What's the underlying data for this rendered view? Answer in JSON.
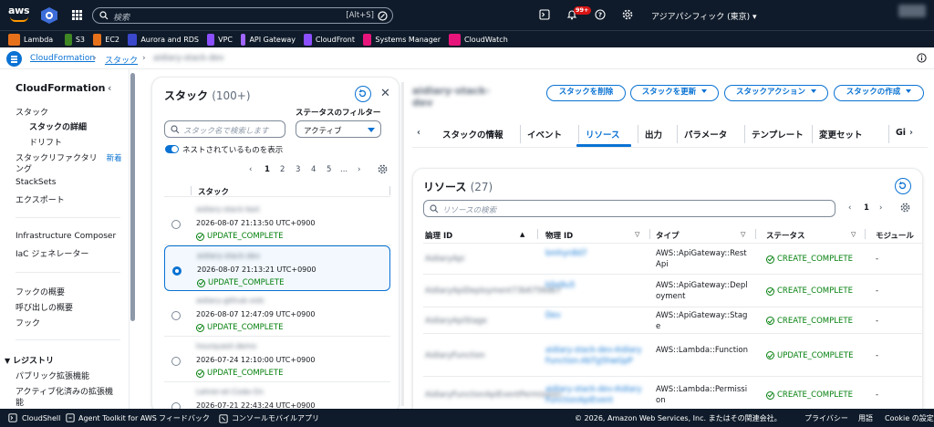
{
  "topbar": {
    "search_placeholder": "検索",
    "search_shortcut": "[Alt+S]",
    "notification_badge": "99+",
    "region": "アジアパシフィック (東京)"
  },
  "favorites": [
    {
      "label": "Lambda",
      "color": "#e7711b"
    },
    {
      "label": "S3",
      "color": "#3f8624"
    },
    {
      "label": "EC2",
      "color": "#e7711b"
    },
    {
      "label": "Aurora and RDS",
      "color": "#3b48cc"
    },
    {
      "label": "VPC",
      "color": "#8c4fff"
    },
    {
      "label": "API Gateway",
      "color": "#a166ff"
    },
    {
      "label": "CloudFront",
      "color": "#8c4fff"
    },
    {
      "label": "Systems Manager",
      "color": "#e7157b"
    },
    {
      "label": "CloudWatch",
      "color": "#e7157b"
    }
  ],
  "breadcrumb": {
    "service": "CloudFormation",
    "stacks": "スタック",
    "current": "aidiary-stack-dev"
  },
  "sidenav": {
    "title": "CloudFormation",
    "items": [
      {
        "label": "スタック",
        "level": 0
      },
      {
        "label": "スタックの詳細",
        "level": 1,
        "active": true
      },
      {
        "label": "ドリフト",
        "level": 1
      },
      {
        "label": "スタックリファクタリ",
        "level": 0,
        "badge": "新着"
      },
      {
        "label": "ング",
        "level": 0
      },
      {
        "label": "StackSets",
        "level": 0
      },
      {
        "label": "エクスポート",
        "level": 0
      },
      {
        "label": "Infrastructure Composer",
        "level": 0
      },
      {
        "label": "IaC ジェネレーター",
        "level": 0
      },
      {
        "label": "フックの概要",
        "level": 0
      },
      {
        "label": "呼び出しの概要",
        "level": 0
      },
      {
        "label": "フック",
        "level": 0
      }
    ],
    "registry_heading": "レジストリ",
    "registry_items": [
      "パブリック拡張機能",
      "アクティブ化済みの拡張機",
      "能"
    ]
  },
  "stack_panel": {
    "title": "スタック",
    "count": "(100+)",
    "search_placeholder": "スタック名で検索します",
    "filter_label": "ステータスのフィルター",
    "filter_value": "アクティブ",
    "nested_toggle_label": "ネストされているものを表示",
    "pages": [
      "1",
      "2",
      "3",
      "4",
      "5",
      "..."
    ],
    "column": "スタック",
    "rows": [
      {
        "name": "aidiary-stack-test",
        "time": "2026-08-07 21:13:50 UTC+0900",
        "status": "UPDATE_COMPLETE",
        "selected": false
      },
      {
        "name": "aidiary-stack-dev",
        "time": "2026-08-07 21:13:21 UTC+0900",
        "status": "UPDATE_COMPLETE",
        "selected": true
      },
      {
        "name": "aidiary-github-oidc",
        "time": "2026-08-07 12:47:09 UTC+0900",
        "status": "UPDATE_COMPLETE",
        "selected": false
      },
      {
        "name": "hourquest-demo",
        "time": "2026-07-24 12:10:00 UTC+0900",
        "status": "UPDATE_COMPLETE",
        "selected": false
      },
      {
        "name": "Lehrer-et-Code-On",
        "time": "2026-07-21 22:43:24 UTC+0900",
        "status": "UPDATE_COMPLETE",
        "selected": false
      }
    ]
  },
  "main": {
    "stack_name": "aidiary-stack-dev",
    "buttons": {
      "delete": "スタックを削除",
      "update": "スタックを更新",
      "actions": "スタックアクション",
      "create": "スタックの作成"
    },
    "tabs": [
      "スタックの情報",
      "イベント",
      "リソース",
      "出力",
      "パラメータ",
      "テンプレート",
      "変更セット",
      "Gi"
    ],
    "active_tab": "リソース"
  },
  "resources": {
    "title": "リソース",
    "count": "(27)",
    "search_placeholder": "リソースの検索",
    "page": "1",
    "columns": [
      "論理 ID",
      "物理 ID",
      "タイプ",
      "ステータス",
      "モジュール"
    ],
    "rows": [
      {
        "logical": "AidiaryApi",
        "physical": "bmhyn8d7",
        "type": "AWS::ApiGateway::RestApi",
        "status": "CREATE_COMPLETE",
        "module": "-"
      },
      {
        "logical": "AidiaryApiDeployment73b6756db7",
        "physical": "b5e9u5",
        "type": "AWS::ApiGateway::Deployment",
        "status": "CREATE_COMPLETE",
        "module": "-"
      },
      {
        "logical": "AidiaryApiStage",
        "physical": "Dev",
        "type": "AWS::ApiGateway::Stage",
        "status": "CREATE_COMPLETE",
        "module": "-"
      },
      {
        "logical": "AidiaryFunction",
        "physical": "aidiary-stack-dev-AidiaryFunction-AbTg5hwGpP",
        "type": "AWS::Lambda::Function",
        "status": "UPDATE_COMPLETE",
        "module": "-"
      },
      {
        "logical": "AidiaryFunctionApiEventPermission",
        "physical": "aidiary-stack-dev-AidiaryFunctionApiEvent",
        "type": "AWS::Lambda::Permission",
        "status": "CREATE_COMPLETE",
        "module": "-"
      }
    ]
  },
  "footer": {
    "cloudshell": "CloudShell",
    "toolkit": "Agent Toolkit for AWS",
    "feedback": "フィードバック",
    "mobile": "コンソールモバイルアプリ",
    "copyright": "© 2026, Amazon Web Services, Inc. またはその関連会社。",
    "privacy": "プライバシー",
    "terms": "用語",
    "cookie": "Cookie の設定"
  }
}
